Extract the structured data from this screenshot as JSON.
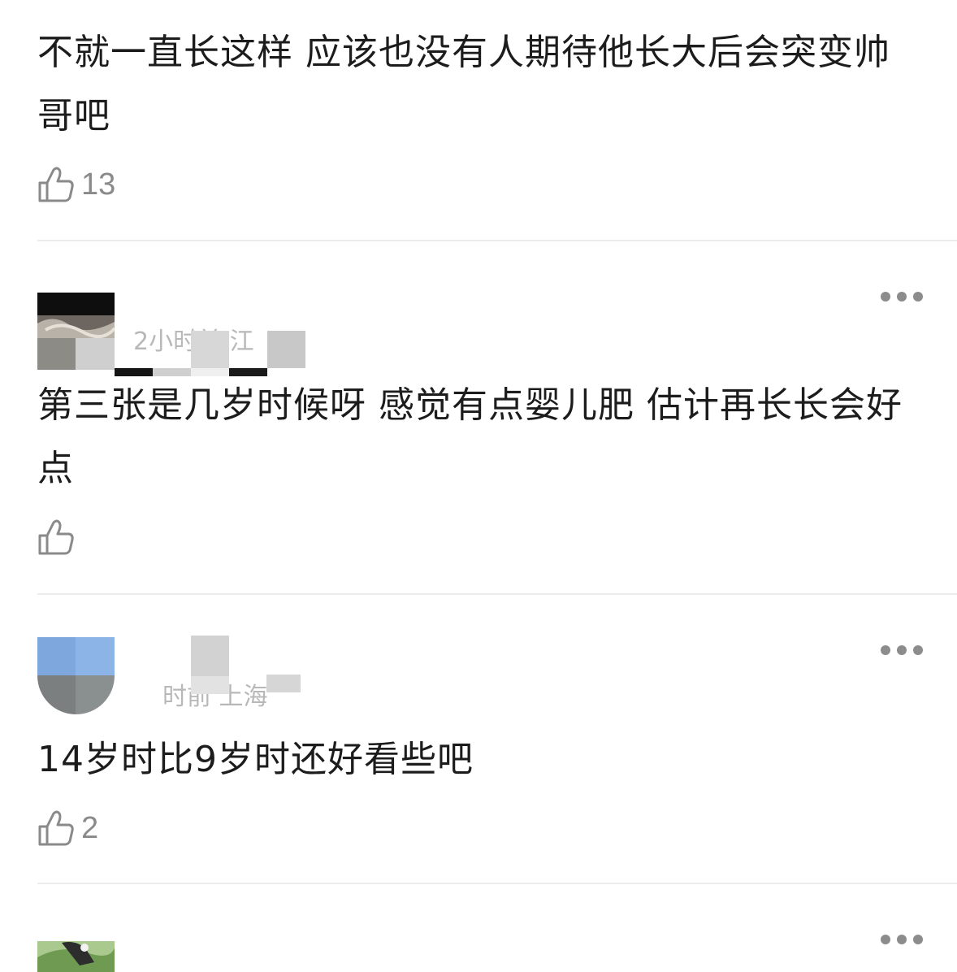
{
  "comments": [
    {
      "text": "不就一直长这样 应该也没有人期待他长大后会突变帅哥吧",
      "likes": "13"
    },
    {
      "text": "第三张是几岁时候呀 感觉有点婴儿肥 估计再长长会好点",
      "likes": "",
      "meta": "2小时前 江"
    },
    {
      "text": "14岁时比9岁时还好看些吧",
      "likes": "2",
      "meta": "时前 上海"
    }
  ],
  "icons": {
    "like": "thumbs-up-icon",
    "more": "more-dots-icon"
  },
  "colors": {
    "text": "#1c1c1c",
    "muted": "#8a8a8a",
    "divider": "#ececec"
  }
}
